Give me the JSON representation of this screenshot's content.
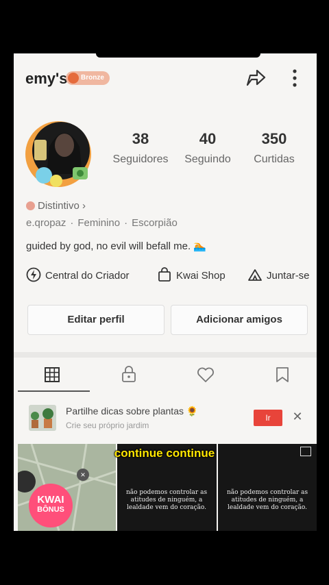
{
  "profile": {
    "username": "emy's",
    "badge": "Bronze",
    "stats": [
      {
        "value": "38",
        "label": "Seguidores"
      },
      {
        "value": "40",
        "label": "Seguindo"
      },
      {
        "value": "350",
        "label": "Curtidas"
      }
    ],
    "distintivo": "Distintivo ›",
    "handle": "e.qropaz",
    "gender": "Feminino",
    "sign": "Escorpião",
    "bio": "guided by god, no evil will befall me. 🏊"
  },
  "links": {
    "creator": "Central do Criador",
    "shop": "Kwai Shop",
    "join": "Juntar-se"
  },
  "buttons": {
    "edit": "Editar perfil",
    "add_friends": "Adicionar amigos"
  },
  "banner": {
    "title": "Partilhe dicas sobre plantas 🌻",
    "subtitle": "Crie seu próprio jardim",
    "go_label": "Ir",
    "close_label": "✕"
  },
  "grid": {
    "kwai_line1": "KWAI",
    "kwai_line2": "BÔNUS",
    "kwai_close": "×",
    "quote": "não podemos controlar as atitudes de ninguém, a lealdade vem do coração."
  },
  "caption": "continue continue",
  "colors": {
    "accent_red": "#e8443a",
    "badge": "#f0b7a0",
    "caption_yellow": "#ffe600"
  }
}
